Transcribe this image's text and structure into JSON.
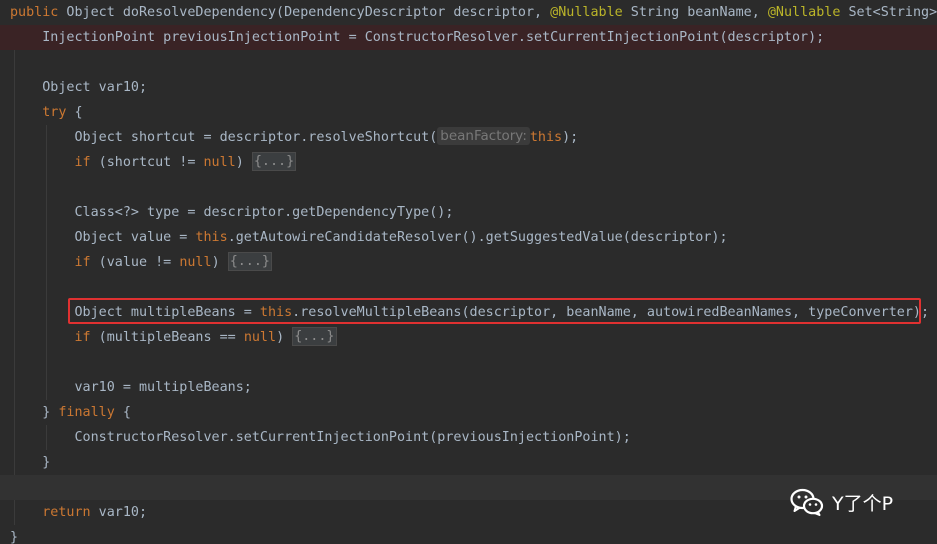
{
  "colors": {
    "background": "#2b2b2b",
    "keyword": "#cc7832",
    "annotation": "#bbb529",
    "text": "#a9b7c6",
    "highlight_border": "#e03131"
  },
  "code": {
    "l1": {
      "a": "public",
      "b": " Object doResolveDependency(DependencyDescriptor descriptor, ",
      "c": "@Nullable",
      "d": " String beanName, ",
      "e": "@Nullable",
      "f": " Set<String>"
    },
    "l2": {
      "a": "    InjectionPoint previousInjectionPoint = ConstructorResolver.setCurrentInjectionPoint(descriptor);"
    },
    "l4": {
      "a": "    Object var10;"
    },
    "l5": {
      "a": "try",
      "b": " {"
    },
    "l6": {
      "a": "        Object shortcut = descriptor.resolveShortcut(",
      "hint": "beanFactory:",
      "b": "this",
      "c": ");"
    },
    "l7": {
      "a": "if",
      "b": " (shortcut != ",
      "c": "null",
      "d": ") ",
      "fold": "{...}"
    },
    "l9": {
      "a": "        Class<?> type = descriptor.getDependencyType();"
    },
    "l10": {
      "a": "        Object value = ",
      "b": "this",
      "c": ".getAutowireCandidateResolver().getSuggestedValue(descriptor);"
    },
    "l11": {
      "a": "if",
      "b": " (value != ",
      "c": "null",
      "d": ") ",
      "fold": "{...}"
    },
    "l13": {
      "a": "        Object multipleBeans = ",
      "b": "this",
      "c": ".resolveMultipleBeans(descriptor, beanName, autowiredBeanNames, typeConverter);"
    },
    "l14": {
      "a": "if",
      "b": " (multipleBeans == ",
      "c": "null",
      "d": ") ",
      "fold": "{...}"
    },
    "l16": {
      "a": "        var10 = multipleBeans;"
    },
    "l17": {
      "a": "    } ",
      "b": "finally",
      "c": " {"
    },
    "l18": {
      "a": "        ConstructorResolver.setCurrentInjectionPoint(previousInjectionPoint);"
    },
    "l19": {
      "a": "    }"
    },
    "l21": {
      "a": "return",
      "b": " var10;"
    },
    "l22": {
      "a": "}"
    }
  },
  "watermark": {
    "icon": "wechat-icon",
    "text": "Y了个P"
  }
}
